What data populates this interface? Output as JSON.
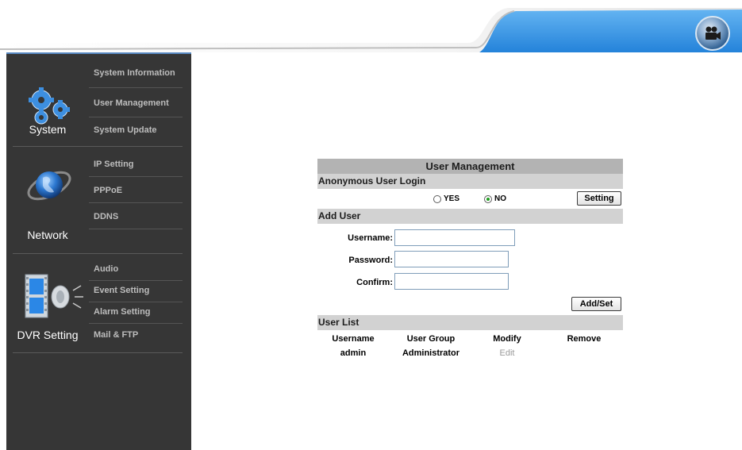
{
  "sidebar": {
    "system": {
      "label": "System",
      "items": [
        "System Information",
        "User Management",
        "System Update"
      ]
    },
    "network": {
      "label": "Network",
      "items": [
        "IP Setting",
        "PPPoE",
        "DDNS"
      ]
    },
    "dvr": {
      "label": "DVR Setting",
      "items": [
        "Audio",
        "Event Setting",
        "Alarm Setting",
        "Mail & FTP"
      ]
    }
  },
  "panel": {
    "title": "User Management",
    "anonymous": {
      "heading": "Anonymous User Login",
      "yes_label": "YES",
      "no_label": "NO",
      "selected": "NO",
      "setting_button": "Setting"
    },
    "add_user": {
      "heading": "Add User",
      "username_label": "Username:",
      "password_label": "Password:",
      "confirm_label": "Confirm:",
      "username_value": "",
      "password_value": "",
      "confirm_value": "",
      "add_button": "Add/Set"
    },
    "user_list": {
      "heading": "User List",
      "columns": [
        "Username",
        "User Group",
        "Modify",
        "Remove"
      ],
      "rows": [
        {
          "username": "admin",
          "group": "Administrator",
          "modify": "Edit",
          "remove": ""
        }
      ]
    }
  },
  "icons": {
    "header": "video-camera-icon",
    "system": "gears-icon",
    "network": "globe-icon",
    "dvr": "film-speaker-icon"
  },
  "colors": {
    "header_blue": "#2f8fe3",
    "sidebar_bg": "#363636",
    "panel_title_bg": "#b3b3b3",
    "bar_bg": "#d2d2d2"
  }
}
